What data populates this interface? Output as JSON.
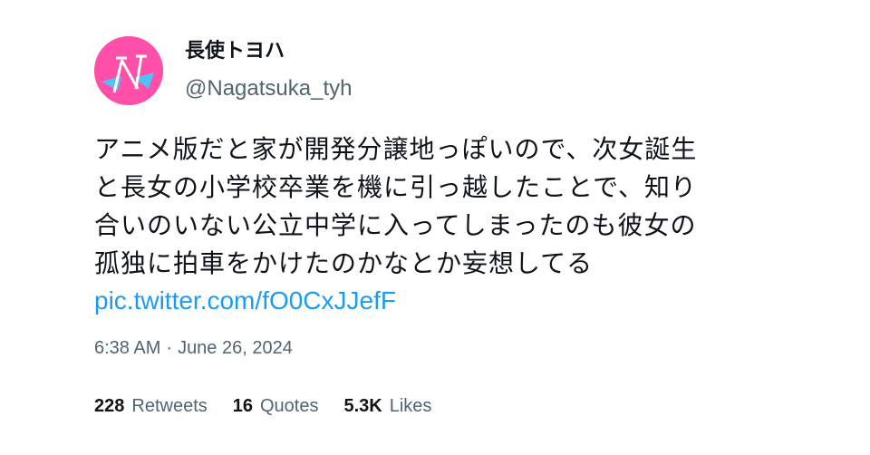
{
  "user": {
    "display_name": "長使トヨハ",
    "handle": "@Nagatsuka_tyh",
    "avatar_letter": "N"
  },
  "tweet": {
    "lines": [
      "アニメ版だと家が開発分譲地っぽいので、次女誕生",
      "と長女の小学校卒業を機に引っ越したことで、知り",
      "合いのいない公立中学に入ってしまったのも彼女の",
      "孤独に拍車をかけたのかなとか妄想してる"
    ],
    "link": "pic.twitter.com/fO0CxJJefF"
  },
  "meta": {
    "time": "6:38 AM",
    "separator": "·",
    "date": "June 26, 2024"
  },
  "stats": {
    "retweets_count": "228",
    "retweets_label": "Retweets",
    "quotes_count": "16",
    "quotes_label": "Quotes",
    "likes_count": "5.3K",
    "likes_label": "Likes"
  },
  "colors": {
    "text": "#0f1419",
    "secondary": "#536471",
    "link": "#1d9bf0",
    "avatar_bg": "#ff4fa8"
  }
}
